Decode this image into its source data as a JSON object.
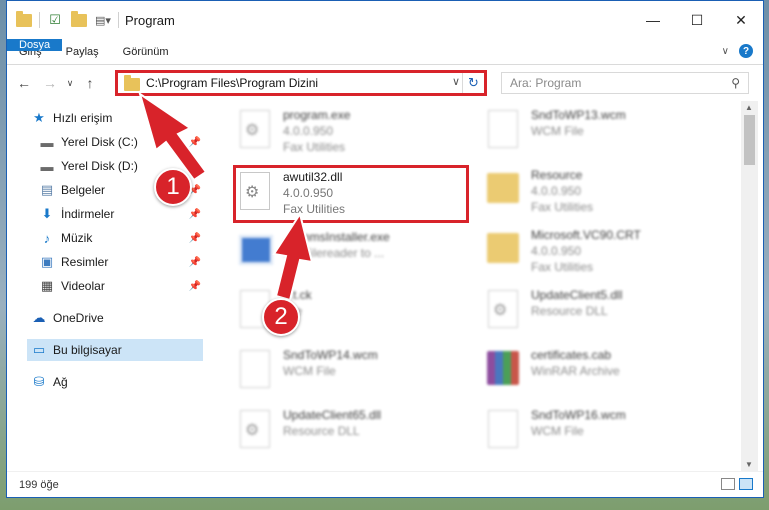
{
  "window": {
    "title": "Program",
    "controls": {
      "minimize": "—",
      "maximize": "☐",
      "close": "✕"
    }
  },
  "ribbon": {
    "tabs": [
      "Dosya",
      "Giriş",
      "Paylaş",
      "Görünüm"
    ],
    "help": "?"
  },
  "nav": {
    "address": "C:\\Program Files\\Program Dizini",
    "search_placeholder": "Ara: Program"
  },
  "sidebar": {
    "items": [
      {
        "label": "Hızlı erişim",
        "icon": "star-icon"
      },
      {
        "label": "Yerel Disk (C:)",
        "icon": "drive-icon",
        "pinned": true
      },
      {
        "label": "Yerel Disk (D:)",
        "icon": "drive-icon",
        "pinned": true
      },
      {
        "label": "Belgeler",
        "icon": "documents-icon",
        "pinned": true
      },
      {
        "label": "İndirmeler",
        "icon": "download-icon",
        "pinned": true
      },
      {
        "label": "Müzik",
        "icon": "music-icon",
        "pinned": true
      },
      {
        "label": "Resimler",
        "icon": "pictures-icon",
        "pinned": true
      },
      {
        "label": "Videolar",
        "icon": "videos-icon",
        "pinned": true
      },
      {
        "label": "OneDrive",
        "icon": "cloud-icon"
      },
      {
        "label": "Bu bilgisayar",
        "icon": "computer-icon",
        "selected": true
      },
      {
        "label": "Ağ",
        "icon": "network-icon"
      }
    ]
  },
  "files": [
    {
      "name": "program.exe",
      "version": "4.0.0.950",
      "desc": "Fax Utilities"
    },
    {
      "name": "SndToWP13.wcm",
      "version": "",
      "desc": "WCM File"
    },
    {
      "name": "awutil32.dll",
      "version": "4.0.0.950",
      "desc": "Fax Utilities"
    },
    {
      "name": "Resource",
      "version": "4.0.0.950",
      "desc": "Fax Utilities"
    },
    {
      "name": "...ammsInstaller.exe",
      "version": "",
      "desc": "...T Filereader to ..."
    },
    {
      "name": "Microsoft.VC90.CRT",
      "version": "4.0.0.950",
      "desc": "Fax Utilities"
    },
    {
      "name": "...t.ck",
      "version": "",
      "desc": "...le"
    },
    {
      "name": "UpdateClient5.dll",
      "version": "",
      "desc": "Resource DLL"
    },
    {
      "name": "SndToWP14.wcm",
      "version": "",
      "desc": "WCM File"
    },
    {
      "name": "certificates.cab",
      "version": "",
      "desc": "WinRAR Archive"
    },
    {
      "name": "UpdateClient65.dll",
      "version": "",
      "desc": "Resource DLL"
    },
    {
      "name": "SndToWP16.wcm",
      "version": "",
      "desc": "WCM File"
    }
  ],
  "status": {
    "count": "199 öğe"
  },
  "annotations": {
    "step1": "1",
    "step2": "2"
  },
  "colors": {
    "accent": "#1979ca",
    "highlight": "#d8232a",
    "selected": "#cce4f7"
  }
}
